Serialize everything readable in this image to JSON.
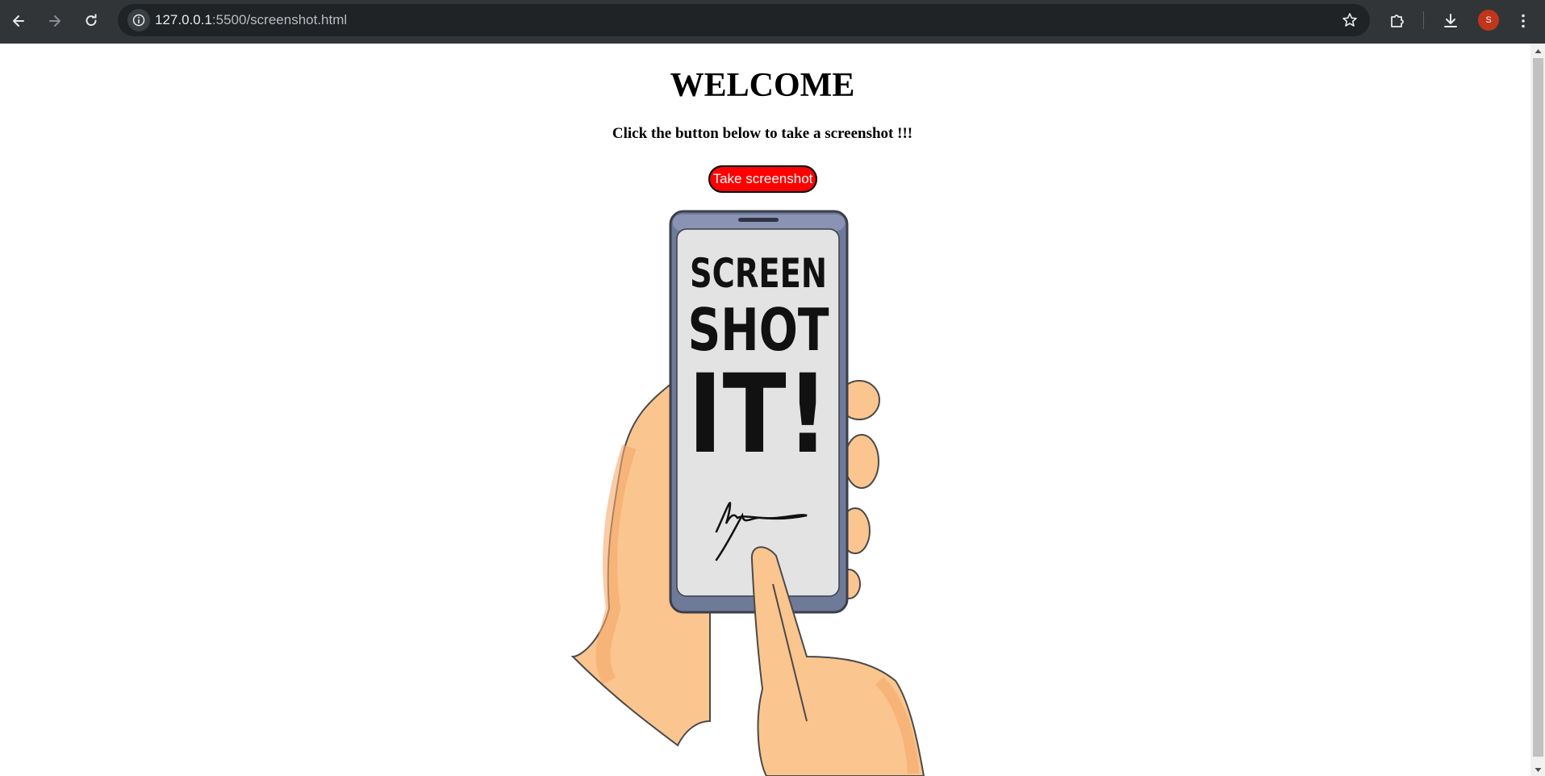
{
  "browser": {
    "url_host": "127.0.0.1",
    "url_path": ":5500/screenshot.html",
    "avatar_initial": "S",
    "icons": {
      "back": "back-arrow-icon",
      "forward": "forward-arrow-icon",
      "reload": "reload-icon",
      "site_info": "info-icon",
      "bookmark": "star-icon",
      "extensions": "puzzle-icon",
      "downloads": "download-icon",
      "menu": "kebab-menu-icon"
    },
    "colors": {
      "frame": "#313538",
      "omnibox": "#1f2326",
      "avatar": "#c1351b"
    }
  },
  "page": {
    "heading": "WELCOME",
    "subtitle": "Click the button below to take a screenshot !!!",
    "button_label": "Take screenshot",
    "button_color": "#ff0000",
    "illustration": {
      "line1": "SCREEN",
      "line2": "SHOT",
      "line3": "IT!"
    }
  }
}
